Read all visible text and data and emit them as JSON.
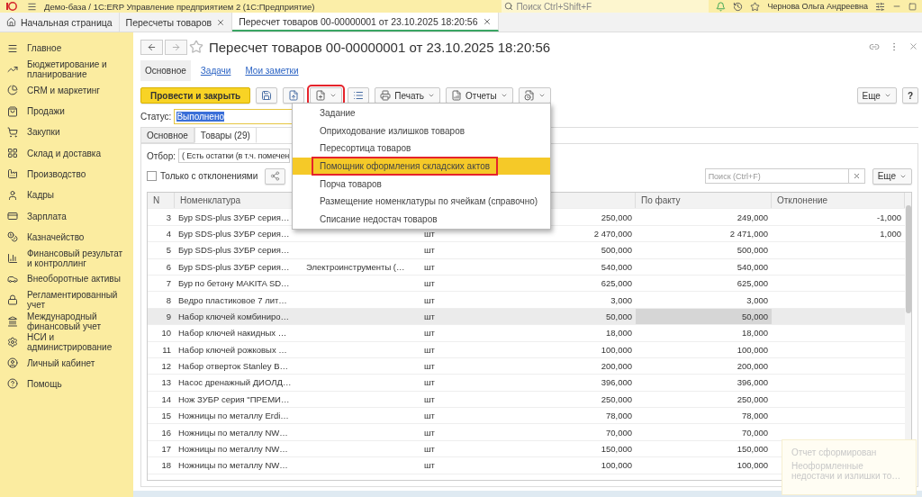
{
  "window": {
    "title": "Демо-база / 1С:ERP Управление предприятием 2  (1С:Предприятие)",
    "search_placeholder": "Поиск Ctrl+Shift+F",
    "user": "Чернова Ольга Андреевна"
  },
  "tabs": [
    {
      "label": "Начальная страница",
      "selected": false,
      "closable": false
    },
    {
      "label": "Пересчеты товаров",
      "selected": false,
      "closable": true
    },
    {
      "label": "Пересчет товаров 00-00000001 от 23.10.2025 18:20:56",
      "selected": true,
      "closable": true
    }
  ],
  "sidebar": {
    "items": [
      {
        "label": "Главное"
      },
      {
        "label": "Бюджетирование и планирование"
      },
      {
        "label": "CRM и маркетинг"
      },
      {
        "label": "Продажи"
      },
      {
        "label": "Закупки"
      },
      {
        "label": "Склад и доставка"
      },
      {
        "label": "Производство"
      },
      {
        "label": "Кадры"
      },
      {
        "label": "Зарплата"
      },
      {
        "label": "Казначейство"
      },
      {
        "label": "Финансовый результат и контроллинг"
      },
      {
        "label": "Внеоборотные активы"
      },
      {
        "label": "Регламентированный учет"
      },
      {
        "label": "Международный финансовый учет"
      },
      {
        "label": "НСИ и администрирование"
      },
      {
        "label": "Личный кабинет"
      },
      {
        "label": "Помощь"
      }
    ]
  },
  "form": {
    "title": "Пересчет товаров 00-00000001 от 23.10.2025 18:20:56",
    "sections": [
      {
        "label": "Основное",
        "selected": true
      },
      {
        "label": "Задачи",
        "selected": false
      },
      {
        "label": "Мои заметки",
        "selected": false
      }
    ],
    "toolbar": [
      {
        "kind": "primary",
        "label": "Провести и закрыть",
        "marked": false
      },
      {
        "kind": "icon",
        "marked": false
      },
      {
        "kind": "icon",
        "marked": false
      },
      {
        "kind": "menu",
        "marked": true
      },
      {
        "kind": "icon",
        "marked": false
      },
      {
        "kind": "menu",
        "label": "Печать",
        "marked": false
      },
      {
        "kind": "menu",
        "label": "Отчеты",
        "marked": false
      },
      {
        "kind": "menu",
        "marked": false
      }
    ],
    "more_label": "Еще",
    "help_label": "?",
    "status_label": "Статус:",
    "status_value": "Выполнено",
    "inner_tabs": [
      {
        "label": "Основное",
        "selected": false
      },
      {
        "label": "Товары (29)",
        "selected": true
      }
    ],
    "filter_label": "Отбор:",
    "filter_value": "( Есть остатки (в т.ч. помечен",
    "only_deviations": {
      "label": "Только с отклонениями",
      "checked": false
    },
    "table_search_placeholder": "Поиск (Ctrl+F)",
    "table_more_label": "Еще"
  },
  "table": {
    "columns": [
      "N",
      "Номенклатура",
      "По факту",
      "Отклонение"
    ],
    "rows": [
      {
        "n": "3",
        "name": "Бур SDS-plus ЗУБР серия…",
        "plan": "250,000",
        "fact": "249,000",
        "deviation": "-1,000",
        "selected": false
      },
      {
        "n": "4",
        "name": "Бур SDS-plus ЗУБР серия…",
        "unit": "шт",
        "plan": "2 470,000",
        "fact": "2 471,000",
        "deviation": "1,000",
        "selected": false
      },
      {
        "n": "5",
        "name": "Бур SDS-plus ЗУБР серия…",
        "unit": "шт",
        "plan": "500,000",
        "fact": "500,000",
        "selected": false
      },
      {
        "n": "6",
        "name": "Бур SDS-plus ЗУБР серия…",
        "column_3": "Электроинструменты (…",
        "unit": "шт",
        "plan": "540,000",
        "fact": "540,000",
        "selected": false
      },
      {
        "n": "7",
        "name": "Бур по бетону MAKITA SD…",
        "unit": "шт",
        "plan": "625,000",
        "fact": "625,000",
        "selected": false
      },
      {
        "n": "8",
        "name": "Ведро пластиковое 7 лит…",
        "unit": "шт",
        "plan": "3,000",
        "fact": "3,000",
        "selected": false
      },
      {
        "n": "9",
        "name": "Набор ключей комбиниро…",
        "unit": "шт",
        "plan": "50,000",
        "fact": "50,000",
        "selected": true
      },
      {
        "n": "10",
        "name": "Набор ключей накидных …",
        "unit": "шт",
        "plan": "18,000",
        "fact": "18,000",
        "selected": false
      },
      {
        "n": "11",
        "name": "Набор ключей рожковых …",
        "unit": "шт",
        "plan": "100,000",
        "fact": "100,000",
        "selected": false
      },
      {
        "n": "12",
        "name": "Набор отверток Stanley B…",
        "unit": "шт",
        "plan": "200,000",
        "fact": "200,000",
        "selected": false
      },
      {
        "n": "13",
        "name": "Насос дренажный ДИОЛД…",
        "unit": "шт",
        "plan": "396,000",
        "fact": "396,000",
        "selected": false
      },
      {
        "n": "14",
        "name": "Нож ЗУБР серия \"ПРЕМИ…",
        "unit": "шт",
        "plan": "250,000",
        "fact": "250,000",
        "selected": false
      },
      {
        "n": "15",
        "name": "Ножницы по металлу Erdi…",
        "unit": "шт",
        "plan": "78,000",
        "fact": "78,000",
        "selected": false
      },
      {
        "n": "16",
        "name": "Ножницы по металлу NW…",
        "unit": "шт",
        "plan": "70,000",
        "fact": "70,000",
        "selected": false
      },
      {
        "n": "17",
        "name": "Ножницы по металлу NW…",
        "unit": "шт",
        "plan": "150,000",
        "fact": "150,000",
        "selected": false
      },
      {
        "n": "18",
        "name": "Ножницы по металлу NW…",
        "unit": "шт",
        "plan": "100,000",
        "fact": "100,000",
        "selected": false
      }
    ]
  },
  "menu": {
    "items": [
      {
        "label": "Задание",
        "selected": false,
        "marked": false
      },
      {
        "label": "Оприходование излишков товаров",
        "selected": false,
        "marked": false
      },
      {
        "label": "Пересортица товаров",
        "selected": false,
        "marked": false
      },
      {
        "label": "Помощник оформления складских актов",
        "selected": true,
        "marked": true
      },
      {
        "label": "Порча товаров",
        "selected": false,
        "marked": false
      },
      {
        "label": "Размещение номенклатуры по ячейкам (справочно)",
        "selected": false,
        "marked": false
      },
      {
        "label": "Списание недостач товаров",
        "selected": false,
        "marked": false
      }
    ]
  },
  "notification": {
    "title": "Отчет сформирован",
    "text": "Неоформленные недостачи и излишки то…"
  }
}
